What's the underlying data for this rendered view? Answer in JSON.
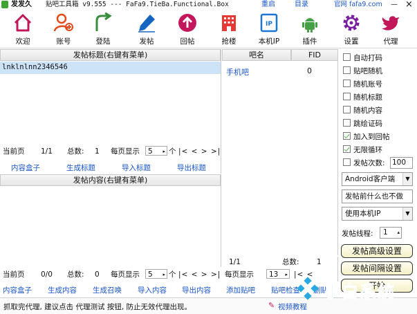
{
  "titlebar": {
    "app_name": "发发久",
    "title_text": "贴吧工具箱 v9.555 --- FaFa9.TieBa.Functional.Box",
    "links": [
      "重启",
      "目录",
      "官网 fafa9.com"
    ],
    "minimize_symbol": "—",
    "close_symbol": "×"
  },
  "toolbar": {
    "items": [
      {
        "label": "欢迎",
        "icon": "home-icon",
        "color": "#c2185b"
      },
      {
        "label": "账号",
        "icon": "user-add-icon",
        "color": "#e64a19"
      },
      {
        "label": "登陆",
        "icon": "login-icon",
        "color": "#388e3c"
      },
      {
        "label": "发帖",
        "icon": "pen-icon",
        "color": "#1565c0"
      },
      {
        "label": "回帖",
        "icon": "upload-icon",
        "color": "#c2185b"
      },
      {
        "label": "抢楼",
        "icon": "building-icon",
        "color": "#e53935"
      },
      {
        "label": "本机IP",
        "icon": "ip-icon",
        "color": "#1976d2"
      },
      {
        "label": "插件",
        "icon": "android-icon",
        "color": "#43a047"
      },
      {
        "label": "设置",
        "icon": "gear-icon",
        "color": "#7b1fa2"
      },
      {
        "label": "代理",
        "icon": "bird-icon",
        "color": "#c2185b"
      }
    ]
  },
  "title_panel": {
    "header": "发帖标题(右键有菜单)",
    "rows": [
      "lnklnlnn2346546"
    ],
    "pager": {
      "current_label": "当前页",
      "page_value": "1/1",
      "total_label": "总数:",
      "total_value": "1",
      "per_page_label": "每页显示",
      "per_page_value": "5",
      "per_unit": "个",
      "nav": "|< < > >|"
    },
    "links": [
      "内容盒子",
      "生成标题",
      "导入标题",
      "导出标题"
    ]
  },
  "content_panel": {
    "header": "发帖内容(右键有菜单)",
    "pager": {
      "current_label": "当前页",
      "page_value": "0/0",
      "total_label": "总数:",
      "total_value": "0",
      "per_page_label": "每页显示",
      "per_page_value": "5",
      "per_unit": "个",
      "nav": "|< < > >|"
    },
    "links": [
      "内容盒子",
      "生成内容",
      "生成召唤",
      "导入内容",
      "导出内容"
    ]
  },
  "bar_panel": {
    "col_name": "吧名",
    "col_fid": "FID",
    "rows": [
      {
        "name": "手机吧",
        "fid": "0"
      }
    ],
    "pager": {
      "page_value": "1/1",
      "total_label": "总数:",
      "total_value": "1",
      "per_page_label": "每页显示",
      "per_page_value": "13",
      "nav": "|< <"
    },
    "links": [
      "添加贴吧",
      "贴吧检查",
      "删贴"
    ]
  },
  "options": {
    "checkboxes": [
      {
        "label": "自动打码",
        "checked": false
      },
      {
        "label": "贴吧随机",
        "checked": false
      },
      {
        "label": "随机账号",
        "checked": false
      },
      {
        "label": "随机标题",
        "checked": false
      },
      {
        "label": "随机内容",
        "checked": false
      },
      {
        "label": "跳绘证码",
        "checked": false
      },
      {
        "label": "加入到回帖",
        "checked": true
      },
      {
        "label": "无限循环",
        "checked": true
      },
      {
        "label": "发帖次数:",
        "checked": false
      }
    ],
    "post_count": "100",
    "client_select": "Android客户端",
    "before_post_select": "发帖前什么也不做",
    "ip_select": "使用本机IP",
    "thread_label": "发帖线程:",
    "thread_value": "1",
    "advanced_button": "发帖高级设置",
    "interval_button": "发帖间隔设置",
    "third_button": "开始"
  },
  "status": {
    "text": "抓取完代理, 建议点击 代理测试 按钮, 防止无效代理出现。",
    "video_link": "视频教程"
  },
  "watermark": {
    "text": "小白系统"
  }
}
